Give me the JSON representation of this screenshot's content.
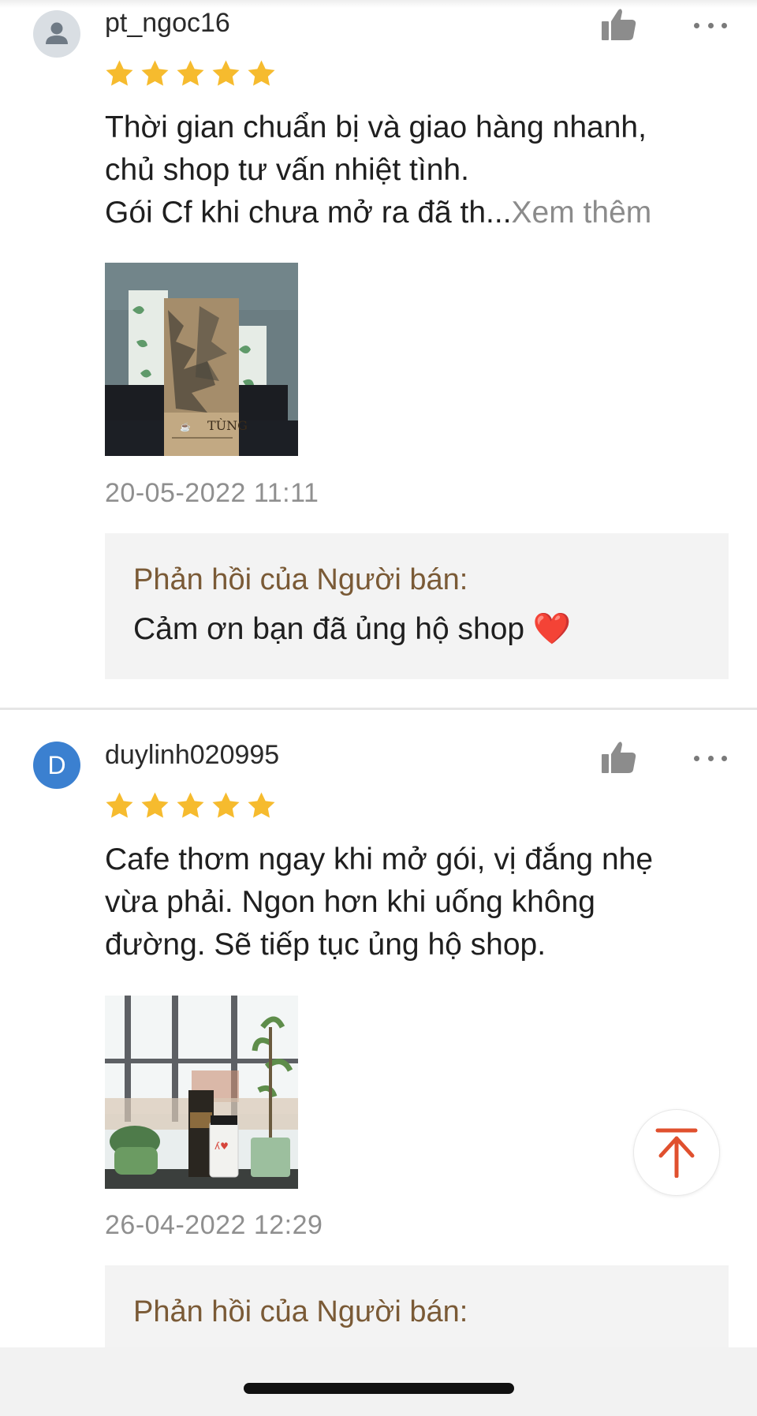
{
  "reviews": [
    {
      "username": "pt_ngoc16",
      "avatar_type": "default-user-icon",
      "rating": 5,
      "text_lines": [
        "Thời gian chuẩn bị và giao hàng nhanh,",
        "chủ shop tư vấn nhiệt tình.",
        "Gói Cf khi chưa mở ra đã th..."
      ],
      "see_more": "Xem thêm",
      "photo_label": "TÙNG",
      "timestamp": "20-05-2022 11:11",
      "seller_reply": {
        "label": "Phản hồi của Người bán:",
        "text": "Cảm ơn bạn đã ủng hộ shop ❤️"
      }
    },
    {
      "username": "duylinh020995",
      "avatar_letter": "D",
      "rating": 5,
      "text_lines": [
        "Cafe thơm ngay khi mở gói, vị đắng nhẹ",
        "vừa phải. Ngon hơn khi uống không",
        "đường. Sẽ tiếp tục ủng hộ shop."
      ],
      "timestamp": "26-04-2022 12:29",
      "seller_reply": {
        "label": "Phản hồi của Người bán:"
      }
    }
  ],
  "icons": {
    "like": "thumbs-up-icon",
    "more": "more-options-icon",
    "scroll_top": "arrow-up-to-top-icon",
    "star": "star-icon"
  },
  "colors": {
    "star": "#f6bb2e",
    "seller_label": "#7a5a36",
    "scroll_top_arrow": "#e0502e",
    "avatar_letter_bg": "#3b80d0"
  }
}
